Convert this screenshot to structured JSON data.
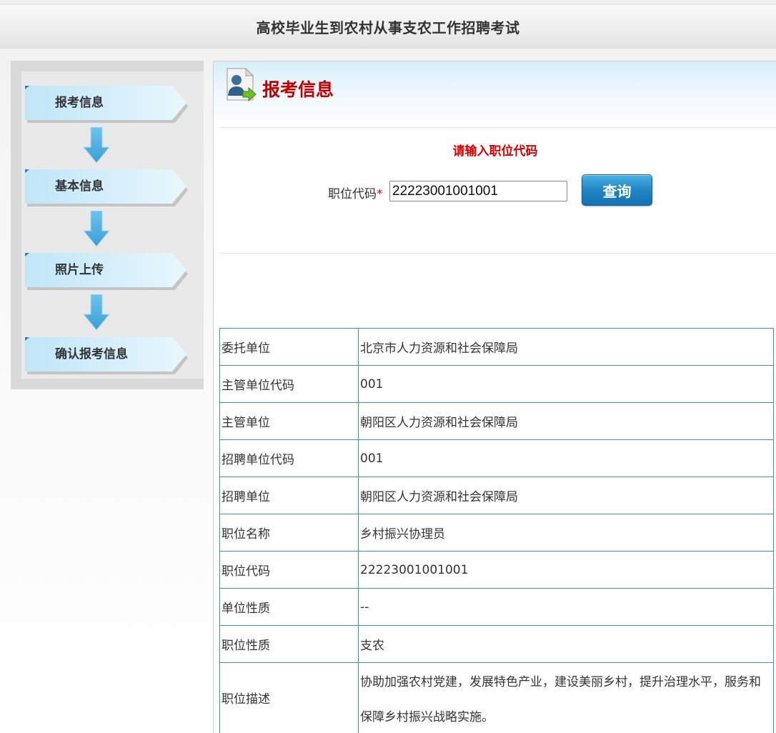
{
  "header": {
    "title": "高校毕业生到农村从事支农工作招聘考试"
  },
  "sidebar": {
    "steps": [
      {
        "label": "报考信息"
      },
      {
        "label": "基本信息"
      },
      {
        "label": "照片上传"
      },
      {
        "label": "确认报考信息"
      }
    ]
  },
  "content": {
    "title": "报考信息",
    "prompt": "请输入职位代码",
    "form": {
      "code_label": "职位代码",
      "required_mark": "*",
      "code_value": "22223001001001",
      "query_label": "查询"
    },
    "table": [
      {
        "key": "委托单位",
        "value": "北京市人力资源和社会保障局"
      },
      {
        "key": "主管单位代码",
        "value": "001"
      },
      {
        "key": "主管单位",
        "value": "朝阳区人力资源和社会保障局"
      },
      {
        "key": "招聘单位代码",
        "value": "001"
      },
      {
        "key": "招聘单位",
        "value": "朝阳区人力资源和社会保障局"
      },
      {
        "key": "职位名称",
        "value": "乡村振兴协理员"
      },
      {
        "key": "职位代码",
        "value": "22223001001001"
      },
      {
        "key": "单位性质",
        "value": "--"
      },
      {
        "key": "职位性质",
        "value": "支农"
      },
      {
        "key": "职位描述",
        "value": "协助加强农村党建，发展特色产业，建设美丽乡村，提升治理水平，服务和保障乡村振兴战略实施。"
      }
    ]
  },
  "colors": {
    "accent_red": "#c00000",
    "button_blue": "#1e86c6",
    "table_border": "#3a95a8",
    "step_blue": "#c6e9f8"
  }
}
